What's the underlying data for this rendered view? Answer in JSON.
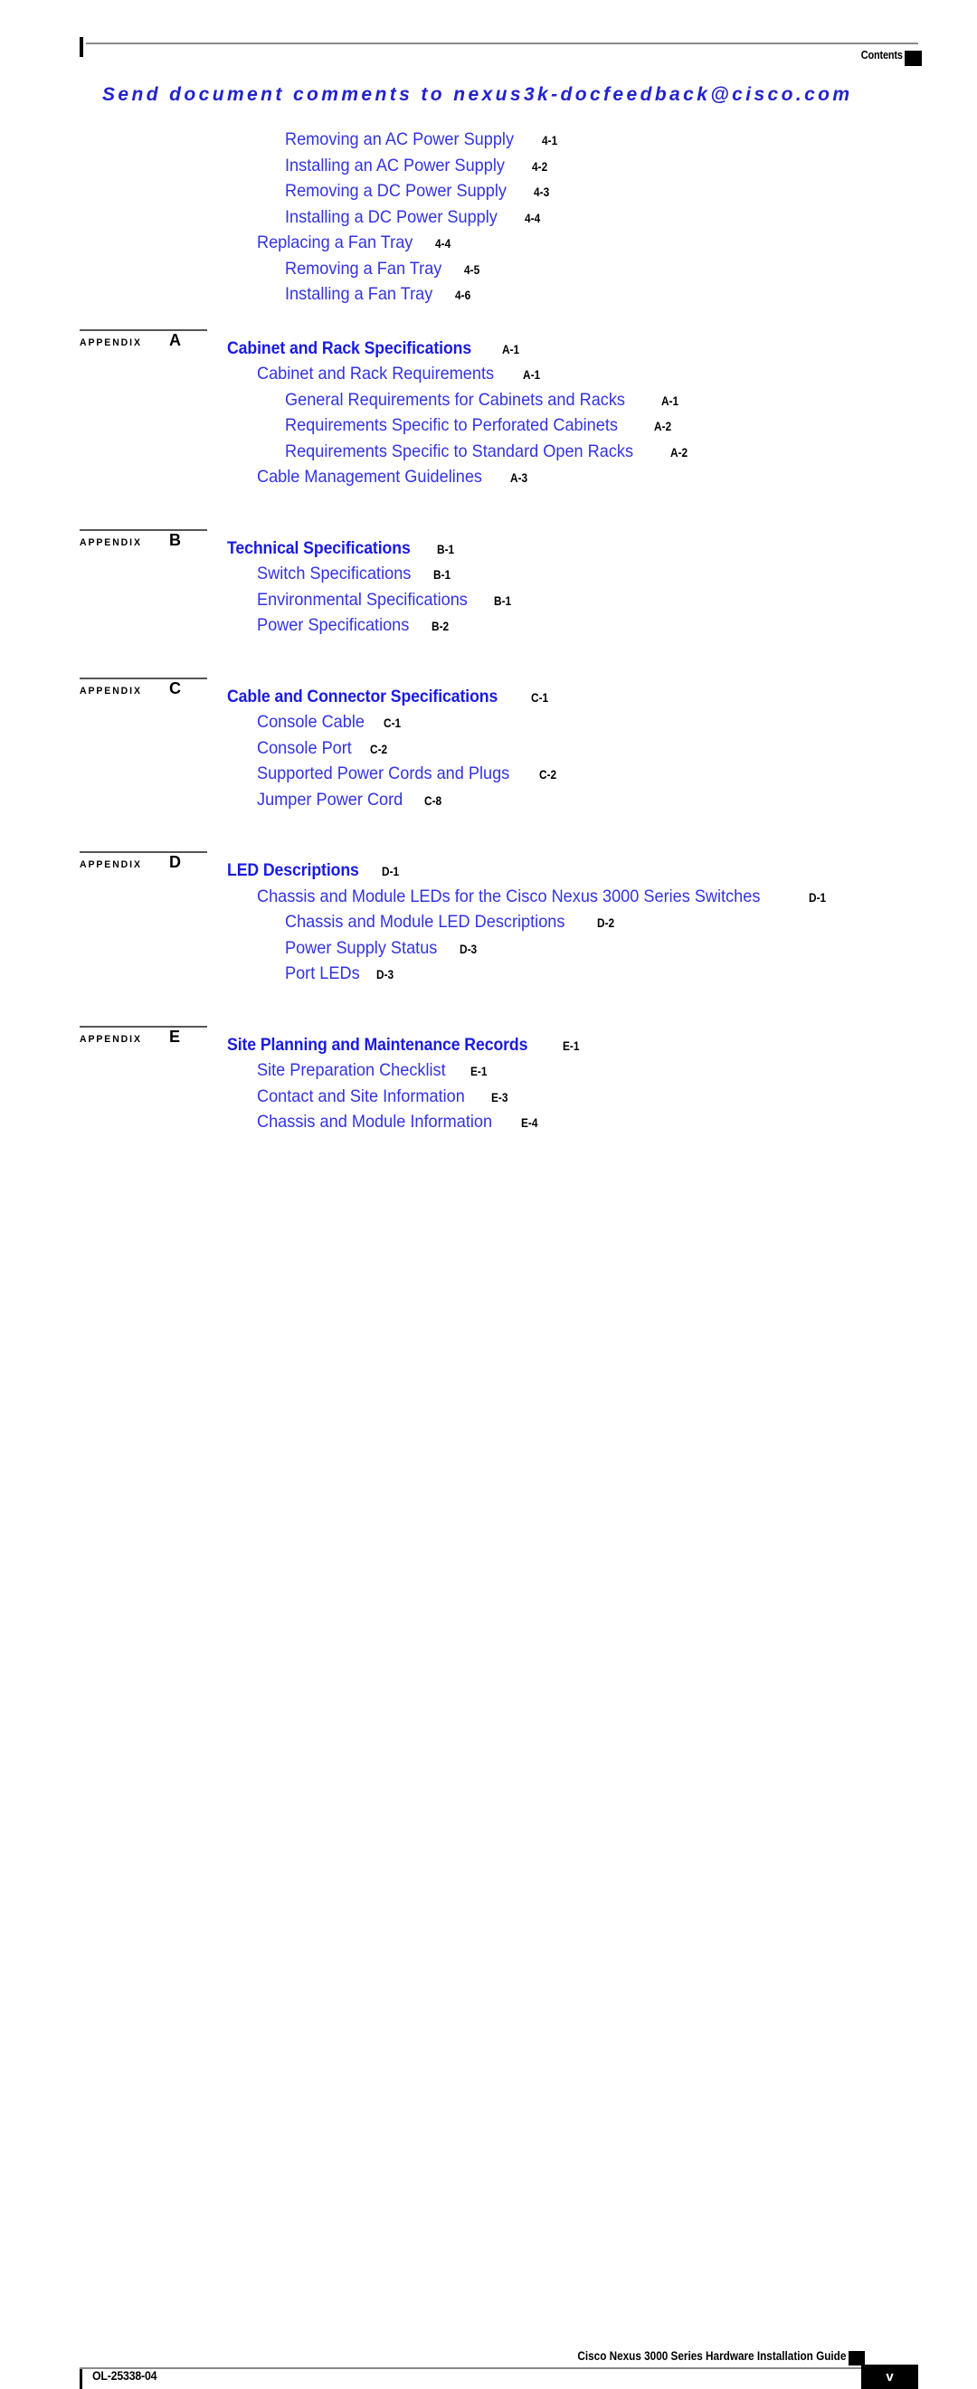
{
  "header": {
    "running_head": "Contents",
    "feedback_banner": "Send document comments to nexus3k-docfeedback@cisco.com"
  },
  "footer": {
    "guide_title": "Cisco Nexus 3000 Series Hardware Installation Guide",
    "doc_id": "OL-25338-04",
    "page_number": "v"
  },
  "toc": {
    "groups": [
      {
        "appendix": null,
        "entries": [
          {
            "level": 2,
            "title": "Removing an AC Power Supply",
            "page": "4-1"
          },
          {
            "level": 2,
            "title": "Installing an AC Power Supply",
            "page": "4-2"
          },
          {
            "level": 2,
            "title": "Removing a DC Power Supply",
            "page": "4-3"
          },
          {
            "level": 2,
            "title": "Installing a DC Power Supply",
            "page": "4-4"
          },
          {
            "level": 1.5,
            "title": "Replacing a Fan Tray",
            "page": "4-4"
          },
          {
            "level": 2,
            "title": "Removing a Fan Tray",
            "page": "4-5"
          },
          {
            "level": 2,
            "title": "Installing a Fan Tray",
            "page": "4-6"
          }
        ]
      },
      {
        "appendix": {
          "word": "APPENDIX",
          "letter": "A"
        },
        "entries": [
          {
            "level": 1,
            "title": "Cabinet and Rack Specifications",
            "page": "A-1"
          },
          {
            "level": 1.5,
            "title": "Cabinet and Rack Requirements",
            "page": "A-1"
          },
          {
            "level": 2,
            "title": "General Requirements for Cabinets and Racks",
            "page": "A-1"
          },
          {
            "level": 2,
            "title": "Requirements Specific to Perforated Cabinets",
            "page": "A-2"
          },
          {
            "level": 2,
            "title": "Requirements Specific to Standard Open Racks",
            "page": "A-2"
          },
          {
            "level": 1.5,
            "title": "Cable Management Guidelines",
            "page": "A-3"
          }
        ]
      },
      {
        "appendix": {
          "word": "APPENDIX",
          "letter": "B"
        },
        "entries": [
          {
            "level": 1,
            "title": "Technical Specifications",
            "page": "B-1"
          },
          {
            "level": 1.5,
            "title": "Switch Specifications",
            "page": "B-1"
          },
          {
            "level": 1.5,
            "title": "Environmental Specifications",
            "page": "B-1"
          },
          {
            "level": 1.5,
            "title": "Power Specifications",
            "page": "B-2"
          }
        ]
      },
      {
        "appendix": {
          "word": "APPENDIX",
          "letter": "C"
        },
        "entries": [
          {
            "level": 1,
            "title": "Cable and Connector Specifications",
            "page": "C-1"
          },
          {
            "level": 1.5,
            "title": "Console Cable",
            "page": "C-1"
          },
          {
            "level": 1.5,
            "title": "Console Port",
            "page": "C-2"
          },
          {
            "level": 1.5,
            "title": "Supported Power Cords and Plugs",
            "page": "C-2"
          },
          {
            "level": 1.5,
            "title": "Jumper Power Cord",
            "page": "C-8"
          }
        ]
      },
      {
        "appendix": {
          "word": "APPENDIX",
          "letter": "D"
        },
        "entries": [
          {
            "level": 1,
            "title": "LED Descriptions",
            "page": "D-1"
          },
          {
            "level": 1.5,
            "title": "Chassis and Module LEDs for the Cisco Nexus 3000 Series Switches",
            "page": "D-1"
          },
          {
            "level": 2,
            "title": "Chassis and Module LED Descriptions",
            "page": "D-2"
          },
          {
            "level": 2,
            "title": "Power Supply Status",
            "page": "D-3"
          },
          {
            "level": 2,
            "title": "Port LEDs",
            "page": "D-3"
          }
        ]
      },
      {
        "appendix": {
          "word": "APPENDIX",
          "letter": "E"
        },
        "entries": [
          {
            "level": 1,
            "title": "Site Planning and Maintenance Records",
            "page": "E-1"
          },
          {
            "level": 1.5,
            "title": "Site Preparation Checklist",
            "page": "E-1"
          },
          {
            "level": 1.5,
            "title": "Contact and Site Information",
            "page": "E-3"
          },
          {
            "level": 1.5,
            "title": "Chassis and Module Information",
            "page": "E-4"
          }
        ]
      }
    ]
  },
  "colors": {
    "link_blue": "#3333e0",
    "heading_blue": "#1a1ae0",
    "banner_blue": "#2222cc",
    "rule_gray": "#8a8a8a"
  }
}
